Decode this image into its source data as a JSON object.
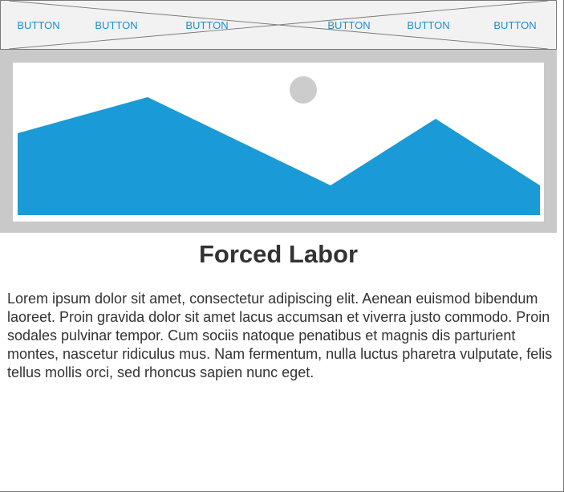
{
  "nav": {
    "buttons": [
      "BUTTON",
      "BUTTON",
      "BUTTON",
      "BUTTON",
      "BUTTON",
      "BUTTON"
    ]
  },
  "hero": {
    "image_icon": "landscape-image-placeholder",
    "sky_color": "#ffffff",
    "mountain_color": "#1a9ad6",
    "sun_color": "#cccccc",
    "frame_color": "#c9c9c9"
  },
  "article": {
    "title": "Forced Labor",
    "body": "Lorem ipsum dolor sit amet, consectetur adipiscing elit. Aenean euismod bibendum laoreet. Proin gravida dolor sit amet lacus accumsan et viverra justo commodo. Proin sodales pulvinar tempor. Cum sociis natoque penatibus et magnis dis parturient montes, nascetur ridiculus mus. Nam fermentum, nulla luctus pharetra vulputate, felis tellus mollis orci, sed rhoncus sapien nunc eget."
  }
}
